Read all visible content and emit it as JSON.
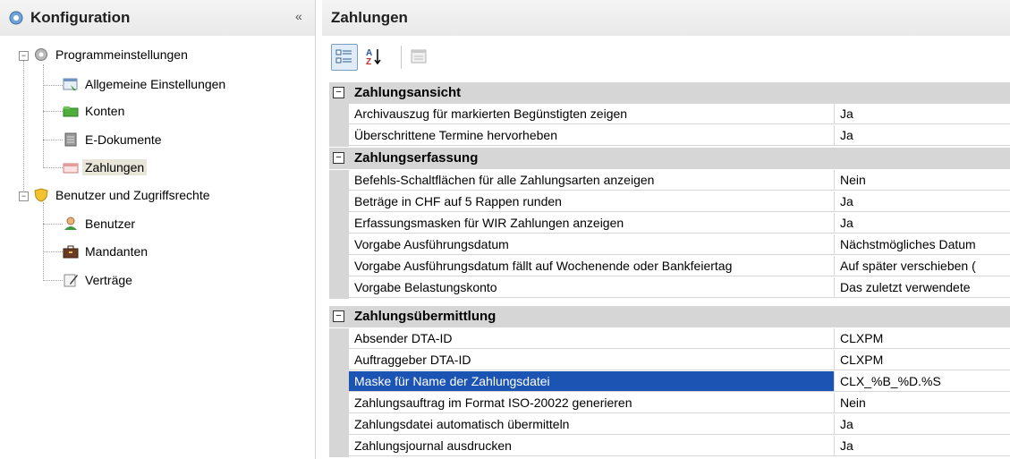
{
  "left": {
    "title": "Konfiguration",
    "collapse_glyph": "«",
    "tree": [
      {
        "label": "Programmeinstellungen",
        "icon": "gear-icon",
        "expander": "−"
      },
      {
        "label": "Allgemeine Einstellungen",
        "icon": "settings-window-icon"
      },
      {
        "label": "Konten",
        "icon": "folder-icon"
      },
      {
        "label": "E-Dokumente",
        "icon": "document-icon"
      },
      {
        "label": "Zahlungen",
        "icon": "payment-icon",
        "selected": true
      },
      {
        "label": "Benutzer und Zugriffsrechte",
        "icon": "shield-icon",
        "expander": "−"
      },
      {
        "label": "Benutzer",
        "icon": "user-icon"
      },
      {
        "label": "Mandanten",
        "icon": "briefcase-icon"
      },
      {
        "label": "Verträge",
        "icon": "contract-pen-icon"
      }
    ]
  },
  "right": {
    "title": "Zahlungen",
    "toolbar": {
      "categorized": "categorized-view-icon",
      "alphabetical": "alphabetical-sort-icon",
      "property_pages": "property-pages-icon"
    },
    "categories": [
      {
        "label": "Zahlungsansicht",
        "toggle": "−",
        "rows": [
          {
            "name": "Archivauszug für markierten Begünstigten zeigen",
            "value": "Ja"
          },
          {
            "name": "Überschrittene Termine hervorheben",
            "value": "Ja"
          }
        ]
      },
      {
        "label": "Zahlungserfassung",
        "toggle": "−",
        "rows": [
          {
            "name": "Befehls-Schaltflächen für alle Zahlungsarten anzeigen",
            "value": "Nein"
          },
          {
            "name": "Beträge in CHF auf 5 Rappen runden",
            "value": "Ja"
          },
          {
            "name": "Erfassungsmasken für WIR Zahlungen anzeigen",
            "value": "Ja"
          },
          {
            "name": "Vorgabe Ausführungsdatum",
            "value": "Nächstmögliches Datum"
          },
          {
            "name": "Vorgabe Ausführungsdatum fällt auf Wochenende oder Bankfeiertag",
            "value": "Auf später verschieben ("
          },
          {
            "name": "Vorgabe Belastungskonto",
            "value": "Das zuletzt verwendete"
          }
        ]
      },
      {
        "label": "Zahlungsübermittlung",
        "toggle": "−",
        "rows": [
          {
            "name": "Absender DTA-ID",
            "value": "CLXPM"
          },
          {
            "name": "Auftraggeber DTA-ID",
            "value": "CLXPM"
          },
          {
            "name": "Maske für Name der Zahlungsdatei",
            "value": "CLX_%B_%D.%S",
            "selected": true
          },
          {
            "name": "Zahlungsauftrag im Format ISO-20022 generieren",
            "value": "Nein"
          },
          {
            "name": "Zahlungsdatei automatisch übermitteln",
            "value": "Ja"
          },
          {
            "name": "Zahlungsjournal ausdrucken",
            "value": "Ja"
          }
        ]
      }
    ]
  },
  "colors": {
    "selection": "#1c54b4",
    "category_bg": "#d6d6d6",
    "tree_selection": "#e8e6d8"
  }
}
